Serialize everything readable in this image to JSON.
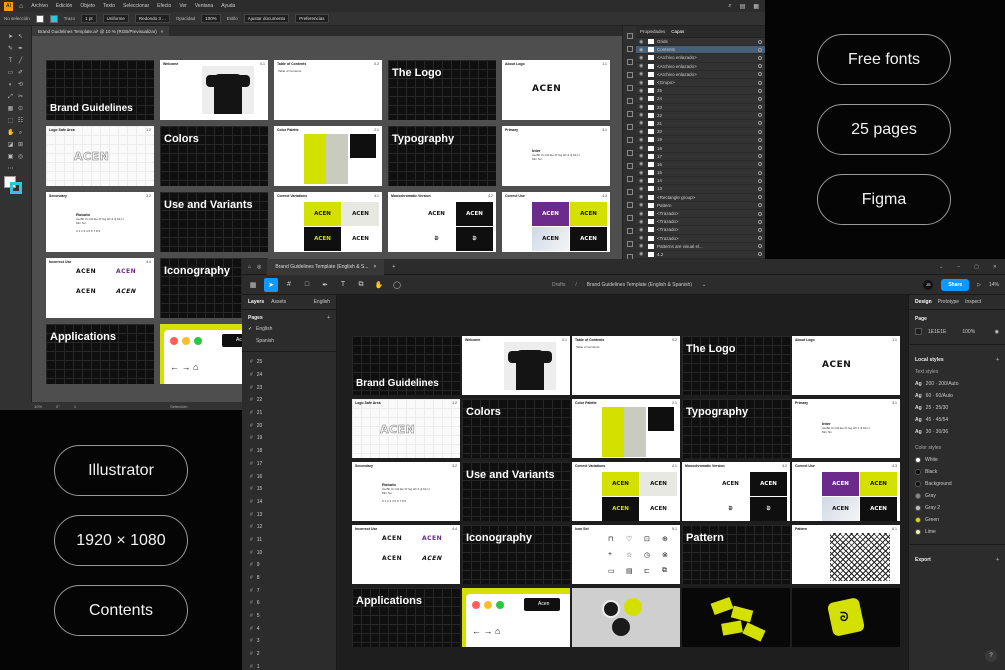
{
  "pills": {
    "free_fonts": "Free fonts",
    "pages": "25 pages",
    "figma": "Figma",
    "illustrator": "Illustrator",
    "resolution": "1920 × 1080",
    "contents": "Contents"
  },
  "illustrator": {
    "logo": "Ai",
    "menu": [
      "Archivo",
      "Edición",
      "Objeto",
      "Texto",
      "Seleccionar",
      "Efecto",
      "Ver",
      "Ventana",
      "Ayuda"
    ],
    "control": {
      "no_selection": "No selección",
      "stroke_label": "Trazo",
      "stroke_value": "1 pt",
      "uniform": "Uniforme",
      "brush": "Redondo 3 ...",
      "opacity_label": "Opacidad",
      "opacity_value": "100%",
      "style_label": "Estilo",
      "doc_setup": "Ajustar documento",
      "prefs": "Preferencias"
    },
    "tab_title": "Brand Guidelines Template.ai* @ 10 % (RGB/Previsualizar)",
    "tab_close": "×",
    "status": {
      "zoom": "10%",
      "angle": "0°",
      "page": "1",
      "selection": "Selección"
    },
    "panel_tabs": [
      "Propiedades",
      "Capas"
    ],
    "layers": [
      "Grids",
      "Contents",
      "<Archivo enlazado>",
      "<Archivo enlazado>",
      "<Archivo enlazado>",
      "<Grupo>",
      "25",
      "24",
      "23",
      "22",
      "21",
      "20",
      "19",
      "18",
      "17",
      "16",
      "15",
      "14",
      "13",
      "<Rectangle group>",
      "Pattern",
      "<Trazado>",
      "<Trazado>",
      "<Trazado>",
      "<Trazado>",
      "Patterns are visual el...",
      "4.2",
      "<Rectángulo>",
      "<Rectángulo>"
    ]
  },
  "figma": {
    "tab_title": "Brand Guidelines Template (English & S...",
    "tab_close": "×",
    "new_tab": "+",
    "breadcrumb_drafts": "Drafts",
    "breadcrumb_sep": "/",
    "breadcrumb_file": "Brand Guidelines Template (English & Spanish)",
    "avatar": "JS",
    "share": "Share",
    "zoom": "14%",
    "left_tabs": [
      "Layers",
      "Assets"
    ],
    "language": "English",
    "pages_label": "Pages",
    "pages": [
      "English",
      "Spanish"
    ],
    "frames": [
      "25",
      "24",
      "23",
      "22",
      "21",
      "20",
      "19",
      "18",
      "17",
      "16",
      "15",
      "14",
      "13",
      "12",
      "11",
      "10",
      "9",
      "8",
      "7",
      "6",
      "5",
      "4",
      "3",
      "2",
      "1"
    ],
    "right_tabs": [
      "Design",
      "Prototype",
      "Inspect"
    ],
    "page_section": "Page",
    "page_fill": "1E1E1E",
    "page_opacity": "100%",
    "local_styles": "Local styles",
    "text_styles": "Text styles",
    "text_style_list": [
      "200 · 200/Auto",
      "60 · 60/Auto",
      "25 · 25/30",
      "45 · 45/54",
      "30 · 30/36"
    ],
    "color_styles": "Color styles",
    "color_style_list": [
      {
        "name": "White",
        "color": "#ffffff"
      },
      {
        "name": "Black",
        "color": "#000000"
      },
      {
        "name": "Background",
        "color": "#0f0f0f"
      },
      {
        "name": "Gray",
        "color": "#8a8a8a"
      },
      {
        "name": "Gray 2",
        "color": "#bdbdbd"
      },
      {
        "name": "Green",
        "color": "#d4e000"
      },
      {
        "name": "Lime",
        "color": "#f0f3b0"
      }
    ],
    "export": "Export",
    "help": "?"
  },
  "slides": {
    "brand_guidelines": "Brand Guidelines",
    "welcome": "Welcome",
    "toc": "Table of Contents",
    "the_logo": "The Logo",
    "about_logo": "About Logo",
    "logo_safe_area": "Logo Safe Area",
    "colors": "Colors",
    "color_palette": "Color Palette",
    "typography": "Typography",
    "primary": "Primary",
    "secondary": "Secondary",
    "use_variants": "Use and Variants",
    "correct_variations": "Correct Variations",
    "monochromatic": "Monochromatic Version",
    "correct_use": "Correct Use",
    "incorrect_use": "Incorrect Use",
    "iconography": "Iconography",
    "icon_set": "Icon Set",
    "pattern": "Pattern",
    "applications": "Applications",
    "logo_word": "ACEN",
    "brand_short": "Acen",
    "font_inter": "Inter",
    "font_roboto": "Roboto",
    "alphabet": "Aa Bb Cc Dd Ee Ff Gg Hh Ii Jj Kk Ll Mm Nn",
    "digits": "0 1 2 3 4 5 6 7 8 9",
    "corner_mark": "Ch",
    "nums": {
      "n01": "0.1",
      "n02": "0.2",
      "n11": "1.1",
      "n12": "1.2",
      "n21": "2.1",
      "n31": "3.1",
      "n32": "3.2",
      "n41": "4.1",
      "n42": "4.2",
      "n43": "4.3",
      "n44": "4.4",
      "n51": "5.1",
      "n61": "6.1"
    }
  },
  "colors": {
    "lime": "#d4e000",
    "purple": "#6b2a8c",
    "accent_blue": "#0d99ff"
  }
}
